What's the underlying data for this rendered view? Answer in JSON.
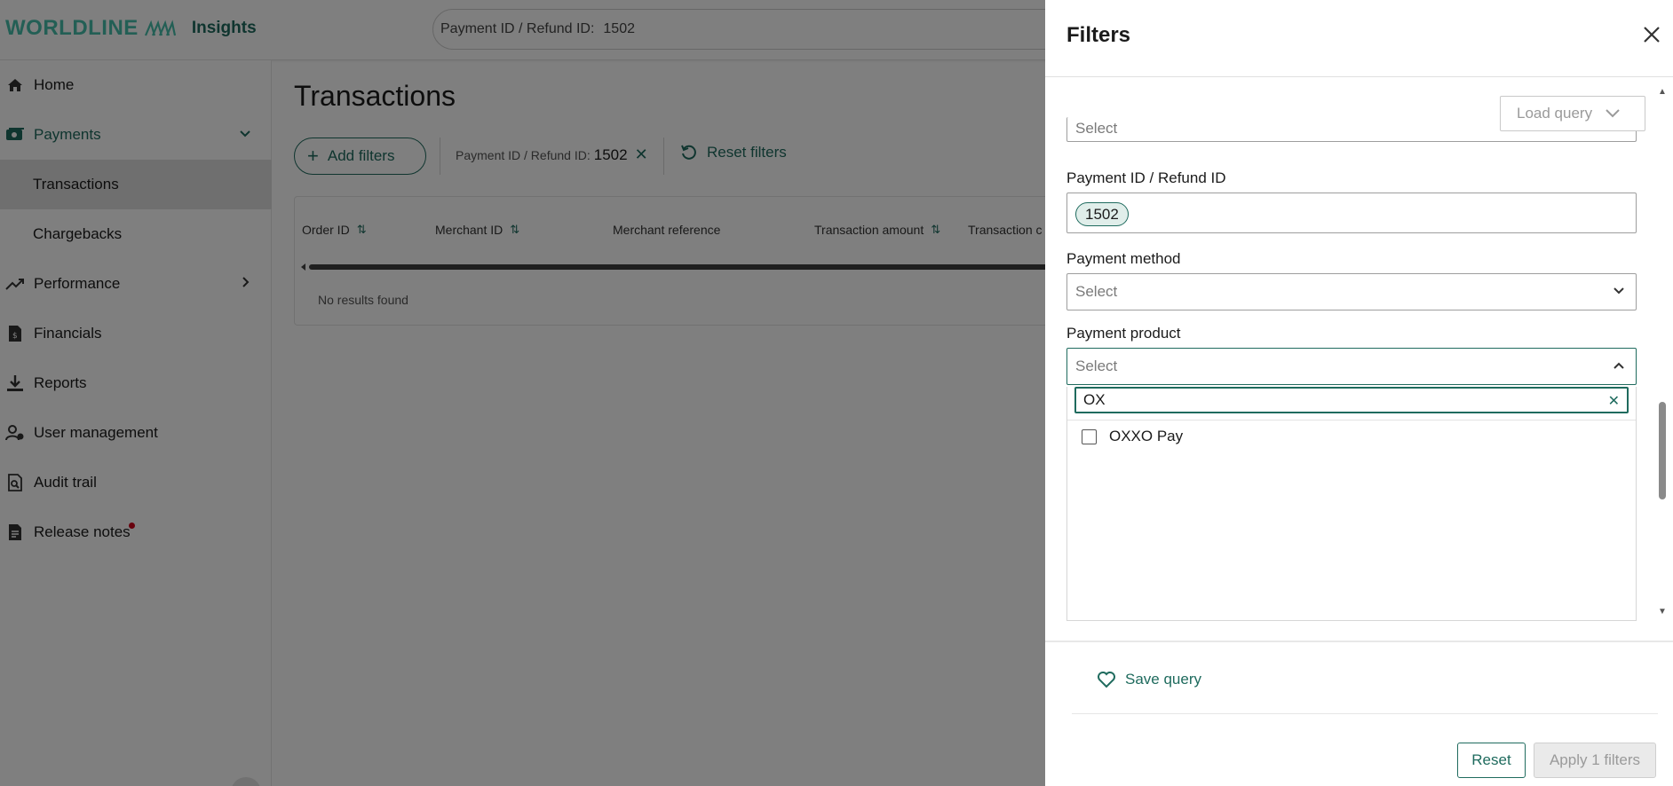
{
  "header": {
    "logo_text": "WORLDLINE",
    "app_name": "Insights",
    "search_label": "Payment ID / Refund ID:",
    "search_value": "1502"
  },
  "sidebar": {
    "items": [
      {
        "label": "Home",
        "icon": "home-icon"
      },
      {
        "label": "Payments",
        "icon": "payments-icon"
      },
      {
        "label": "Transactions"
      },
      {
        "label": "Chargebacks"
      },
      {
        "label": "Performance",
        "icon": "trend-icon"
      },
      {
        "label": "Financials",
        "icon": "financials-icon"
      },
      {
        "label": "Reports",
        "icon": "download-icon"
      },
      {
        "label": "User management",
        "icon": "users-icon"
      },
      {
        "label": "Audit trail",
        "icon": "audit-icon"
      },
      {
        "label": "Release notes",
        "icon": "notes-icon"
      }
    ]
  },
  "main": {
    "title": "Transactions",
    "add_filters": "Add filters",
    "chip_label": "Payment ID / Refund ID:",
    "chip_value": "1502",
    "reset_filters": "Reset filters",
    "columns": [
      "Order ID",
      "Merchant ID",
      "Merchant reference",
      "Transaction amount",
      "Transaction c"
    ],
    "empty_text": "No results found"
  },
  "filters": {
    "title": "Filters",
    "load_query": "Load query",
    "top_select_placeholder": "Select",
    "payment_id_label": "Payment ID / Refund ID",
    "payment_id_tag": "1502",
    "payment_method_label": "Payment method",
    "payment_method_placeholder": "Select",
    "payment_product_label": "Payment product",
    "payment_product_placeholder": "Select",
    "search_value": "OX",
    "options": [
      "OXXO Pay"
    ],
    "save_query": "Save query",
    "reset": "Reset",
    "apply": "Apply 1 filters"
  },
  "colors": {
    "brand": "#46beaa",
    "accent": "#1f6b5e"
  }
}
